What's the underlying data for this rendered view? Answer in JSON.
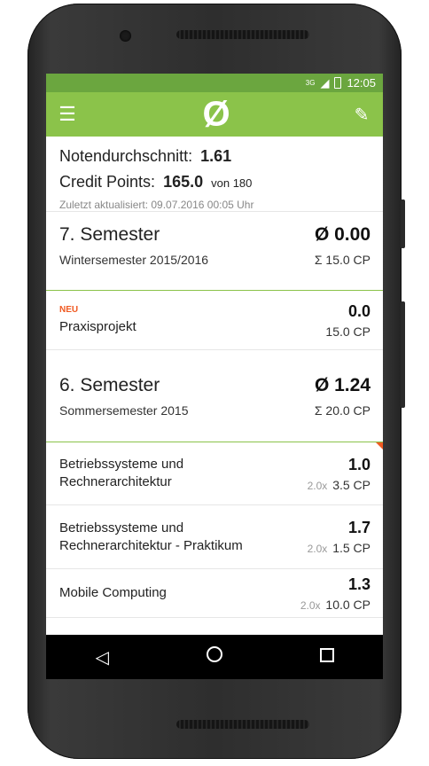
{
  "status": {
    "signal": "3G",
    "time": "12:05"
  },
  "toolbar": {
    "menu_icon": "menu-icon",
    "logo": "Ø",
    "edit_icon": "edit-icon"
  },
  "summary": {
    "avg_label": "Notendurchschnitt:",
    "avg_value": "1.61",
    "cp_label": "Credit Points:",
    "cp_value": "165.0",
    "cp_total": "von 180",
    "updated": "Zuletzt aktualisiert:  09.07.2016 00:05 Uhr"
  },
  "semesters": [
    {
      "name": "7. Semester",
      "subtitle": "Wintersemester 2015/2016",
      "avg": "Ø 0.00",
      "cp": "Σ 15.0 CP",
      "courses": [
        {
          "badge": "NEU",
          "name": "Praxisprojekt",
          "grade": "0.0",
          "weight": "",
          "cp": "15.0 CP"
        }
      ]
    },
    {
      "name": "6. Semester",
      "subtitle": "Sommersemester 2015",
      "avg": "Ø 1.24",
      "cp": "Σ 20.0 CP",
      "courses": [
        {
          "name": "Betriebssysteme und Rechnerarchitektur",
          "grade": "1.0",
          "weight": "2.0x",
          "cp": "3.5 CP"
        },
        {
          "name": "Betriebssysteme und Rechnerarchitektur - Praktikum",
          "grade": "1.7",
          "weight": "2.0x",
          "cp": "1.5 CP"
        },
        {
          "name": "Mobile Computing",
          "grade": "1.3",
          "weight": "2.0x",
          "cp": "10.0 CP"
        }
      ]
    }
  ],
  "colors": {
    "primary": "#8bc34a",
    "status": "#6ba63f",
    "accent": "#f05a22"
  }
}
